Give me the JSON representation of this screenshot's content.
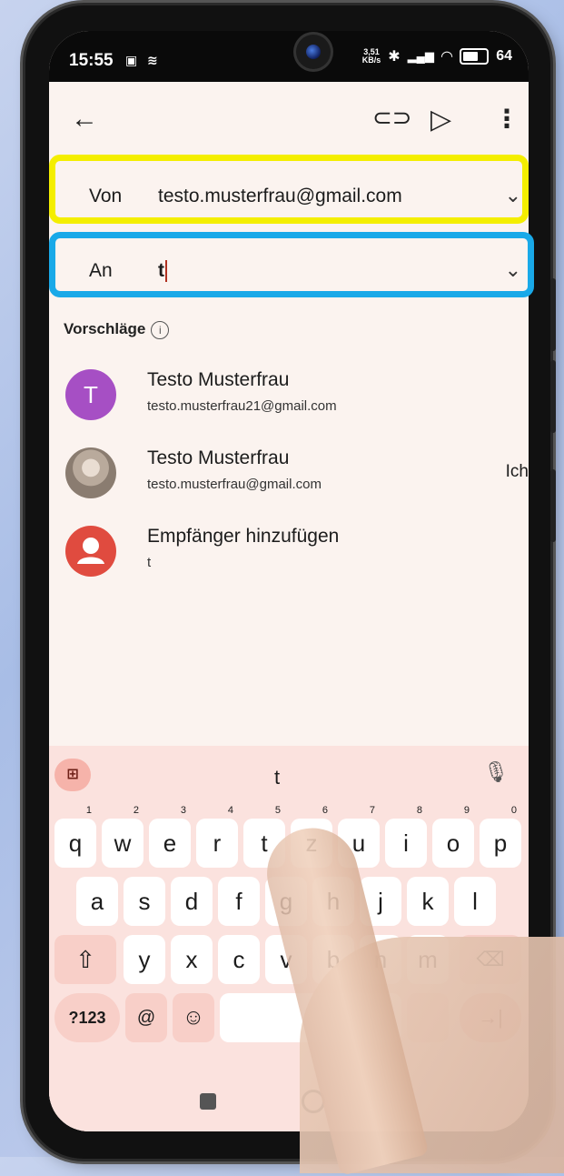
{
  "status_bar": {
    "time": "15:55",
    "net_speed_value": "3,51",
    "net_speed_unit": "KB/s",
    "battery": "64"
  },
  "toolbar": {
    "back_icon": "arrow-left-icon",
    "attach_icon": "paperclip-icon",
    "send_icon": "send-icon",
    "more_icon": "more-vert-icon"
  },
  "from_field": {
    "label": "Von",
    "value": "testo.musterfrau@gmail.com"
  },
  "to_field": {
    "label": "An",
    "value": "t"
  },
  "suggestions": {
    "title": "Vorschläge",
    "items": [
      {
        "avatar_letter": "T",
        "avatar_color": "#a64fc4",
        "name": "Testo Musterfrau",
        "email": "testo.musterfrau21@gmail.com",
        "tag": ""
      },
      {
        "avatar_letter": "",
        "avatar_color": "#9a8f86",
        "name": "Testo Musterfrau",
        "email": "testo.musterfrau@gmail.com",
        "tag": "Ich"
      },
      {
        "avatar_letter": "",
        "avatar_color": "#e04b3f",
        "name": "Empfänger hinzufügen",
        "email": "t",
        "tag": ""
      }
    ]
  },
  "keyboard": {
    "suggestion": "t",
    "row1": [
      "q",
      "w",
      "e",
      "r",
      "t",
      "z",
      "u",
      "i",
      "o",
      "p"
    ],
    "row1_digits": [
      "1",
      "2",
      "3",
      "4",
      "5",
      "6",
      "7",
      "8",
      "9",
      "0"
    ],
    "row2": [
      "a",
      "s",
      "d",
      "f",
      "g",
      "h",
      "j",
      "k",
      "l"
    ],
    "row3": [
      "y",
      "x",
      "c",
      "v",
      "b",
      "n",
      "m"
    ],
    "symbols_key": "?123",
    "at_key": "@"
  },
  "colors": {
    "highlight_from": "#f4ee00",
    "highlight_to": "#19a9e8",
    "keyboard_bg": "#fbe2de"
  }
}
